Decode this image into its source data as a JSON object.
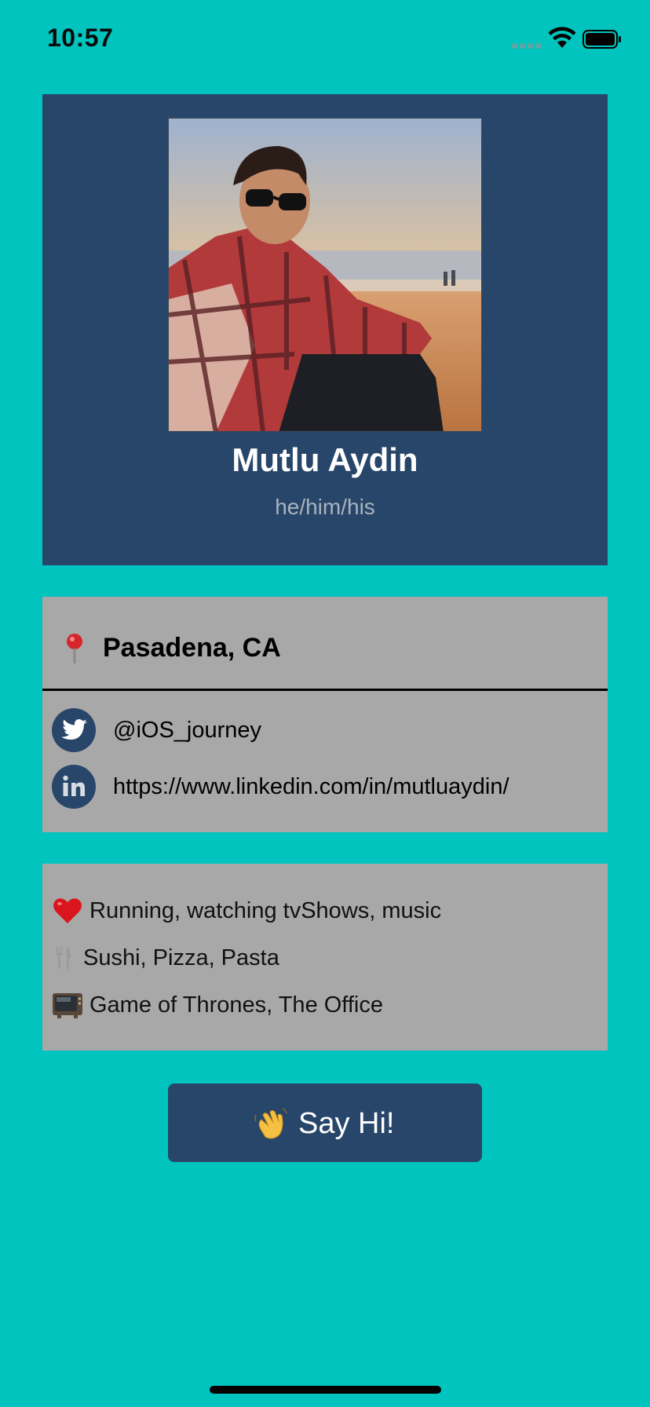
{
  "status_bar": {
    "time": "10:57"
  },
  "profile": {
    "name": "Mutlu Aydin",
    "pronouns": "he/him/his",
    "photo_icon": "profile-photo"
  },
  "contact": {
    "location": "Pasadena, CA",
    "location_icon": "map-pin-icon",
    "twitter": "@iOS_journey",
    "linkedin": "https://www.linkedin.com/in/mutluaydin/"
  },
  "interests": {
    "hobbies": "Running, watching tvShows, music",
    "food": "Sushi, Pizza, Pasta",
    "shows": "Game of Thrones, The Office"
  },
  "button": {
    "label": "Say Hi!",
    "icon": "waving-hand-icon"
  },
  "colors": {
    "background": "#00C4BD",
    "card_dark": "#27466A",
    "card_gray": "#A8A8A8"
  }
}
